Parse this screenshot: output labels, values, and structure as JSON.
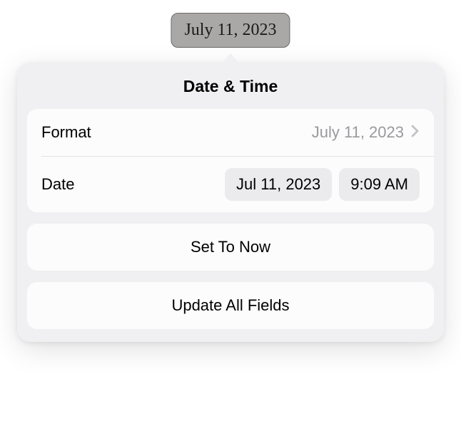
{
  "field_preview": "July 11, 2023",
  "popover": {
    "title": "Date & Time",
    "format": {
      "label": "Format",
      "value": "July 11, 2023"
    },
    "date": {
      "label": "Date",
      "date_value": "Jul 11, 2023",
      "time_value": "9:09 AM"
    },
    "set_to_now": "Set To Now",
    "update_all": "Update All Fields"
  }
}
